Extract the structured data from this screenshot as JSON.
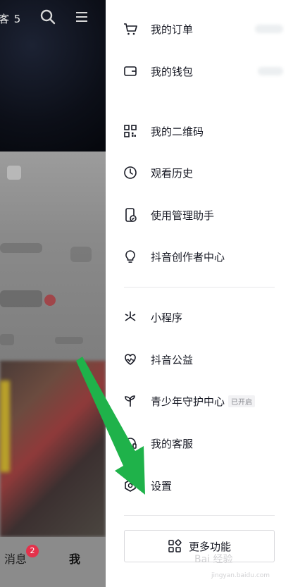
{
  "background": {
    "top_label": "客 5",
    "nav": {
      "messages_label": "消息",
      "messages_badge": "2",
      "me_label": "我"
    }
  },
  "drawer": {
    "section1": [
      {
        "label": "我的订单",
        "icon": "cart-icon"
      },
      {
        "label": "我的钱包",
        "icon": "wallet-icon"
      },
      {
        "label": "我的二维码",
        "icon": "qr-code-icon"
      },
      {
        "label": "观看历史",
        "icon": "clock-icon"
      },
      {
        "label": "使用管理助手",
        "icon": "phone-check-icon"
      },
      {
        "label": "抖音创作者中心",
        "icon": "lightbulb-icon"
      }
    ],
    "section2": [
      {
        "label": "小程序",
        "icon": "mini-program-icon"
      },
      {
        "label": "抖音公益",
        "icon": "charity-heart-icon"
      },
      {
        "label": "青少年守护中心",
        "icon": "sprout-icon",
        "tag": "已开启"
      },
      {
        "label": "我的客服",
        "icon": "headset-icon"
      },
      {
        "label": "设置",
        "icon": "hexagon-gear-icon"
      }
    ],
    "more_button": {
      "label": "更多功能",
      "icon": "grid-icon"
    }
  },
  "watermark": {
    "text": "Bai 经验",
    "sub": "jingyan.baidu.com"
  },
  "colors": {
    "accent_arrow": "#1fb24a",
    "badge": "#e4314b",
    "text": "#161823"
  }
}
